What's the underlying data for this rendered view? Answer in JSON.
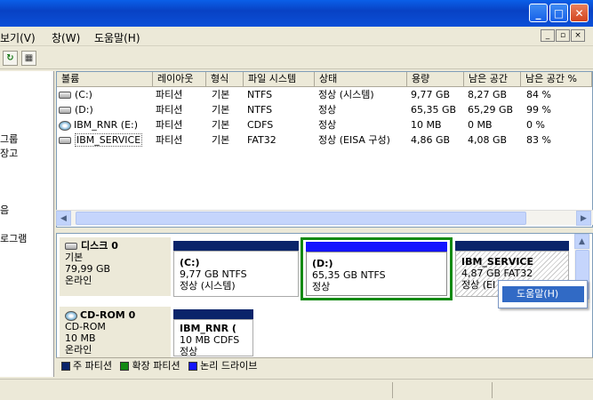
{
  "menu": {
    "items": [
      "보기(V)",
      "창(W)",
      "도움말(H)"
    ]
  },
  "left_pane": {
    "texts": [
      "그룹",
      "장고",
      "음",
      "로그램"
    ]
  },
  "table": {
    "headers": [
      "볼륨",
      "레이아웃",
      "형식",
      "파일 시스템",
      "상태",
      "용량",
      "남은 공간",
      "남은 공간 %"
    ],
    "rows": [
      {
        "icon": "drive-icon",
        "volume": "(C:)",
        "layout": "파티션",
        "type": "기본",
        "fs": "NTFS",
        "status": "정상 (시스템)",
        "capacity": "9,77 GB",
        "free": "8,27 GB",
        "pct": "84 %"
      },
      {
        "icon": "drive-icon",
        "volume": "(D:)",
        "layout": "파티션",
        "type": "기본",
        "fs": "NTFS",
        "status": "정상",
        "capacity": "65,35 GB",
        "free": "65,29 GB",
        "pct": "99 %"
      },
      {
        "icon": "cdrom-icon",
        "volume": "IBM_RNR (E:)",
        "layout": "파티션",
        "type": "기본",
        "fs": "CDFS",
        "status": "정상",
        "capacity": "10 MB",
        "free": "0 MB",
        "pct": "0 %"
      },
      {
        "icon": "drive-icon",
        "volume": "IBM_SERVICE",
        "layout": "파티션",
        "type": "기본",
        "fs": "FAT32",
        "status": "정상 (EISA 구성)",
        "capacity": "4,86 GB",
        "free": "4,08 GB",
        "pct": "83 %"
      }
    ]
  },
  "disks": {
    "disk0": {
      "name": "디스크 0",
      "type": "기본",
      "size": "79,99 GB",
      "state": "온라인",
      "partitions": [
        {
          "name": "(C:)",
          "size": "9,77 GB NTFS",
          "status": "정상 (시스템)"
        },
        {
          "name": "(D:)",
          "size": "65,35 GB NTFS",
          "status": "정상"
        },
        {
          "name": "IBM_SERVICE",
          "size": "4,87 GB FAT32",
          "status": "정상 (EI"
        }
      ]
    },
    "cdrom0": {
      "name": "CD-ROM 0",
      "type": "CD-ROM",
      "size": "10 MB",
      "state": "온라인",
      "partition": {
        "name": "IBM_RNR (",
        "size": "10 MB CDFS",
        "status": "정상"
      }
    }
  },
  "legend": {
    "primary": "주 파티션",
    "extended": "확장 파티션",
    "logical": "논리 드라이브",
    "colors": {
      "primary": "#0a246a",
      "extended": "#138a13",
      "logical": "#1414ff"
    }
  },
  "context_menu": {
    "item": "도움말(H)"
  },
  "window_controls": {
    "minimize": "_",
    "maximize": "□",
    "close": "✕",
    "mdi": [
      "_",
      "▫",
      "×"
    ]
  }
}
